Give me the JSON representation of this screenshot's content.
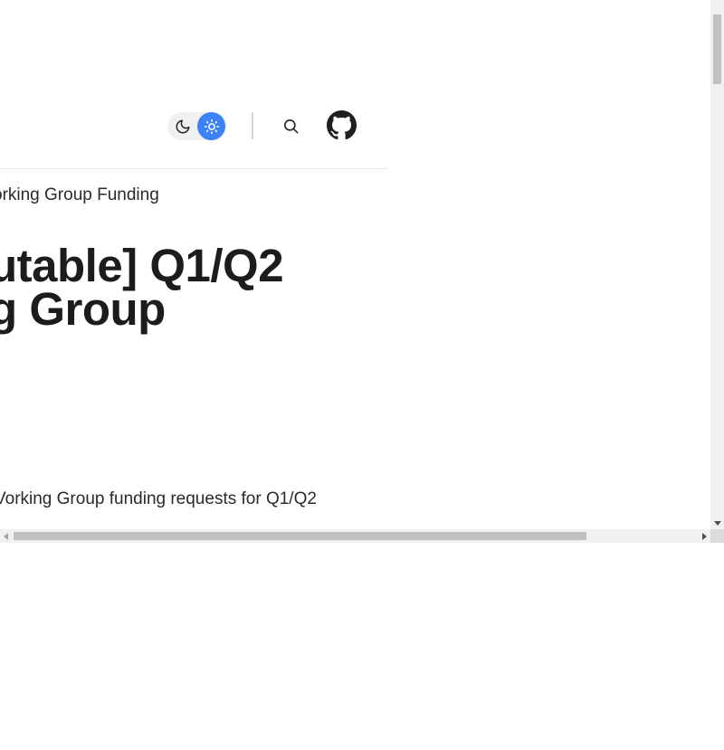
{
  "header": {
    "theme_toggle": {
      "options": [
        "moon-icon",
        "sun-icon"
      ],
      "selected": "light"
    },
    "search_icon": "search-icon",
    "github_icon": "github-icon"
  },
  "breadcrumb": "orking Group Funding",
  "title": {
    "line1": "utable] Q1/Q2",
    "line2": "g Group"
  },
  "description": "Vorking Group funding requests for Q1/Q2",
  "colors": {
    "accent": "#3b82f6",
    "text": "#1f1f1f",
    "toggle_bg": "#f0f0f0"
  }
}
